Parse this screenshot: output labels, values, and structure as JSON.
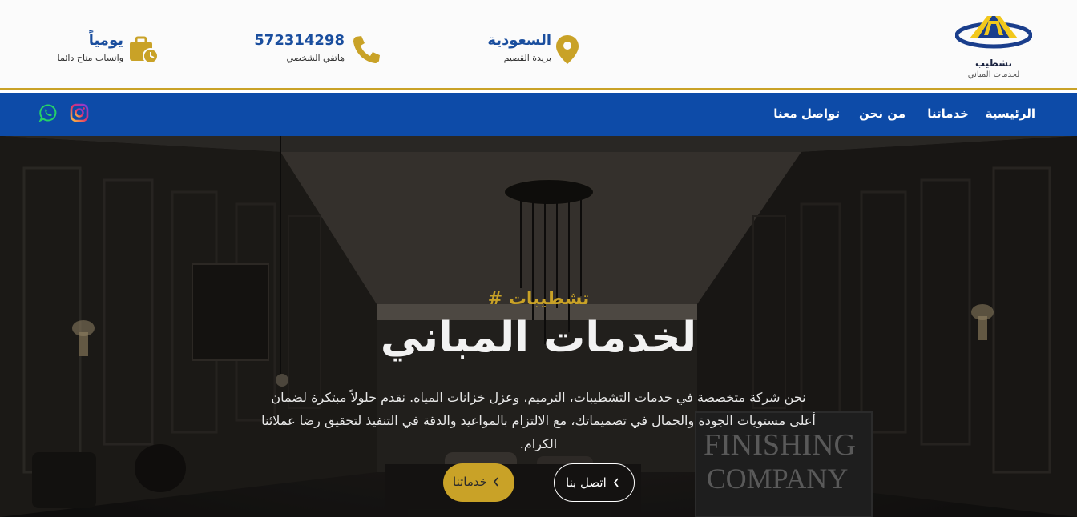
{
  "header": {
    "logo": {
      "title": "تشطيب",
      "subtitle": "لخدمات المباني"
    },
    "location": {
      "title": "السعودية",
      "subtitle": "بريدة القصيم",
      "icon": "location-pin-icon"
    },
    "phone": {
      "title": "572314298",
      "subtitle": "هاتفي الشخصي",
      "icon": "phone-icon"
    },
    "daily": {
      "title": "يومياً",
      "subtitle": "واتساب متاح دائما",
      "icon": "briefcase-clock-icon"
    }
  },
  "nav": {
    "items": [
      {
        "label": "الرئيسية"
      },
      {
        "label": "خدماتنا"
      },
      {
        "label": "من نحن"
      },
      {
        "label": "تواصل معنا"
      }
    ],
    "social": [
      "instagram-icon",
      "whatsapp-icon"
    ]
  },
  "hero": {
    "tag": "# تشطيبات",
    "title": "لخدمات المباني",
    "description": "نحن شركة متخصصة في خدمات التشطيبات، الترميم، وعزل خزانات المياه. نقدم حلولاً مبتكرة لضمان أعلى مستويات الجودة والجمال في تصميماتك، مع الالتزام بالمواعيد والدقة في التنفيذ لتحقيق رضا عملائنا الكرام.",
    "sign": [
      "FINISHING",
      "COMPANY"
    ],
    "buttons": {
      "contact": "اتصل بنا",
      "services": "خدماتنا"
    }
  },
  "colors": {
    "primary": "#0d4ba8",
    "accent": "#c9a227",
    "title_blue": "#1a4e9e"
  }
}
